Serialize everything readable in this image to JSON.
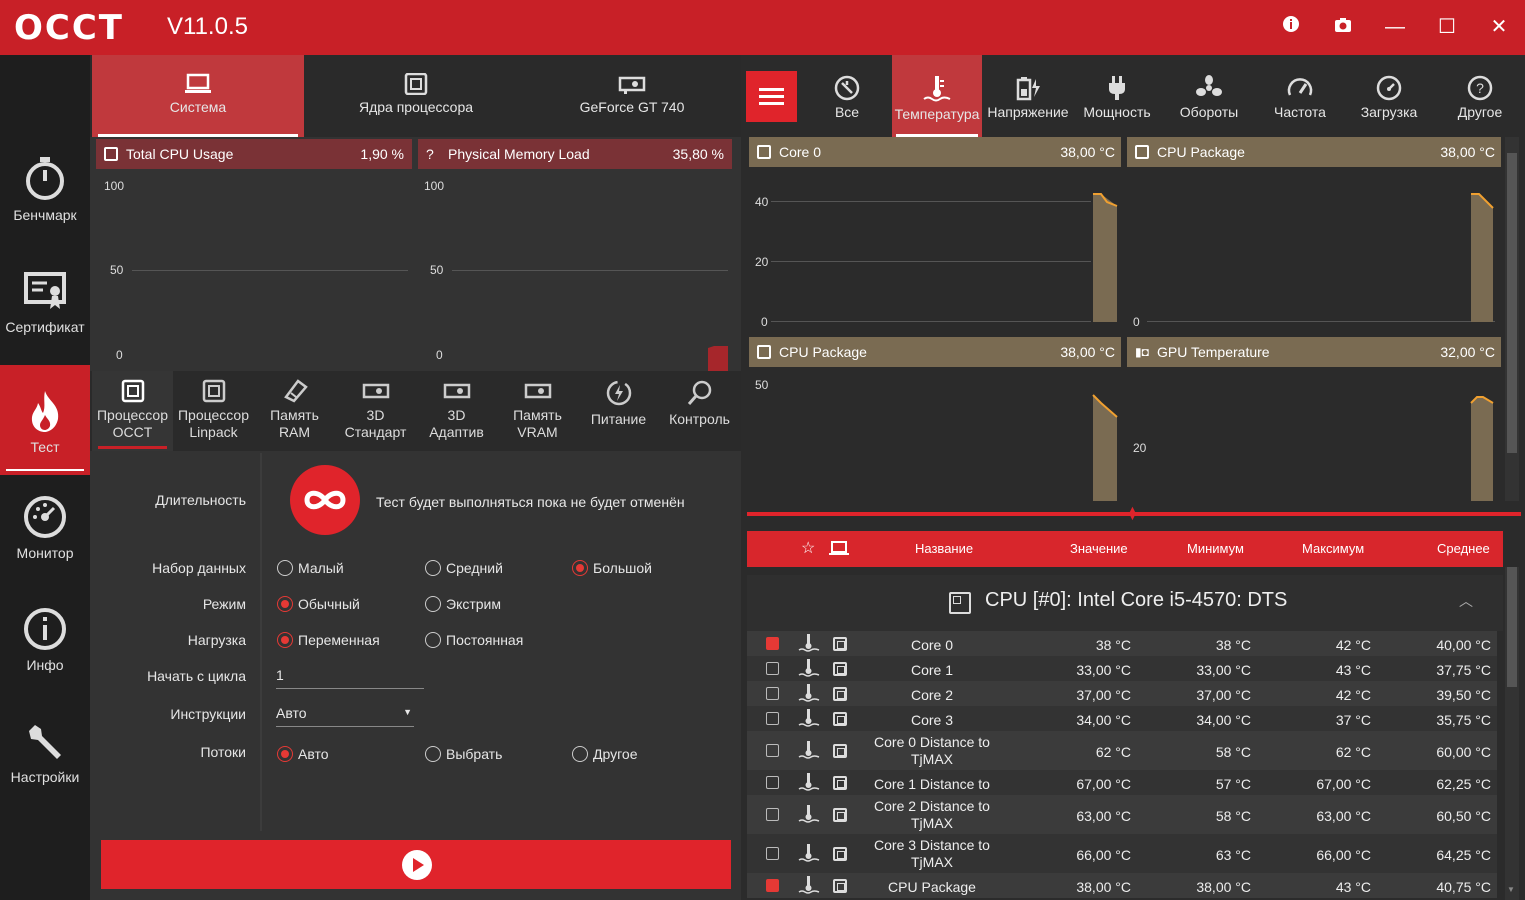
{
  "app": {
    "logo": "OCCT",
    "version": "V11.0.5"
  },
  "titlebar": {
    "info": "i",
    "camera": "camera-icon",
    "minimize": "—",
    "maximize": "☐",
    "close": "✕"
  },
  "sidebar": {
    "items": [
      {
        "label": "Бенчмарк",
        "icon": "stopwatch-icon"
      },
      {
        "label": "Сертификат",
        "icon": "certificate-icon"
      },
      {
        "label": "Тест",
        "icon": "flame-icon",
        "active": true
      },
      {
        "label": "Монитор",
        "icon": "gauge-icon"
      },
      {
        "label": "Инфо",
        "icon": "info-icon"
      },
      {
        "label": "Настройки",
        "icon": "wrench-icon"
      }
    ]
  },
  "left_tabs": [
    {
      "label": "Система",
      "active": true
    },
    {
      "label": "Ядра процессора"
    },
    {
      "label": "GeForce GT 740"
    }
  ],
  "cpu_chart": {
    "name": "Total CPU Usage",
    "value": "1,90 %",
    "ticks": [
      "100",
      "50",
      "0"
    ]
  },
  "mem_chart": {
    "name": "Physical Memory Load",
    "value": "35,80 %",
    "ticks": [
      "100",
      "50",
      "0"
    ]
  },
  "tests": [
    {
      "l1": "Процессор",
      "l2": "OCCT",
      "active": true
    },
    {
      "l1": "Процессор",
      "l2": "Linpack"
    },
    {
      "l1": "Память",
      "l2": "RAM"
    },
    {
      "l1": "3D",
      "l2": "Стандарт"
    },
    {
      "l1": "3D",
      "l2": "Адаптив"
    },
    {
      "l1": "Память",
      "l2": "VRAM"
    },
    {
      "l1": "Питание",
      "l2": ""
    },
    {
      "l1": "Контроль",
      "l2": ""
    }
  ],
  "settings": {
    "duration_label": "Длительность",
    "duration_text": "Тест будет выполняться пока не будет отменён",
    "dataset_label": "Набор данных",
    "dataset_opts": [
      "Малый",
      "Средний",
      "Большой"
    ],
    "mode_label": "Режим",
    "mode_opts": [
      "Обычный",
      "Экстрим"
    ],
    "load_label": "Нагрузка",
    "load_opts": [
      "Переменная",
      "Постоянная"
    ],
    "start_cycle_label": "Начать с цикла",
    "start_cycle_value": "1",
    "instructions_label": "Инструкции",
    "instructions_value": "Авто",
    "threads_label": "Потоки",
    "threads_opts": [
      "Авто",
      "Выбрать",
      "Другое"
    ]
  },
  "monitor_tabs": [
    {
      "label": "Все",
      "icon": "all-icon"
    },
    {
      "label": "Температура",
      "icon": "thermometer-icon",
      "active": true
    },
    {
      "label": "Напряжение",
      "icon": "battery-icon"
    },
    {
      "label": "Мощность",
      "icon": "plug-icon"
    },
    {
      "label": "Обороты",
      "icon": "fan-icon"
    },
    {
      "label": "Частота",
      "icon": "speedometer-icon"
    },
    {
      "label": "Загрузка",
      "icon": "load-icon"
    },
    {
      "label": "Другое",
      "icon": "question-icon"
    }
  ],
  "temp_charts": [
    {
      "name": "Core 0",
      "value": "38,00 °C",
      "ticks": [
        "40",
        "20",
        "0"
      ]
    },
    {
      "name": "CPU Package",
      "value": "38,00 °C",
      "ticks": [
        "0"
      ]
    },
    {
      "name": "CPU Package",
      "value": "38,00 °C",
      "ticks": [
        "50"
      ]
    },
    {
      "name": "GPU Temperature",
      "value": "32,00 °C",
      "ticks": [
        "20"
      ]
    }
  ],
  "table": {
    "headers": {
      "name": "Название",
      "value": "Значение",
      "min": "Минимум",
      "max": "Максимум",
      "avg": "Среднее"
    },
    "group": "CPU [#0]: Intel Core i5-4570: DTS",
    "rows": [
      {
        "checked": true,
        "name": "Core 0",
        "value": "38 °C",
        "min": "38 °C",
        "max": "42 °C",
        "avg": "40,00 °C"
      },
      {
        "checked": false,
        "name": "Core 1",
        "value": "33,00 °C",
        "min": "33,00 °C",
        "max": "43 °C",
        "avg": "37,75 °C"
      },
      {
        "checked": false,
        "name": "Core 2",
        "value": "37,00 °C",
        "min": "37,00 °C",
        "max": "42 °C",
        "avg": "39,50 °C"
      },
      {
        "checked": false,
        "name": "Core 3",
        "value": "34,00 °C",
        "min": "34,00 °C",
        "max": "37 °C",
        "avg": "35,75 °C"
      },
      {
        "checked": false,
        "name": "Core 0 Distance to TjMAX",
        "value": "62 °C",
        "min": "58 °C",
        "max": "62 °C",
        "avg": "60,00 °C"
      },
      {
        "checked": false,
        "name": "Core 1 Distance to TjMAX",
        "value": "67,00 °C",
        "min": "57 °C",
        "max": "67,00 °C",
        "avg": "62,25 °C"
      },
      {
        "checked": false,
        "name": "Core 2 Distance to TjMAX",
        "value": "63,00 °C",
        "min": "58 °C",
        "max": "63,00 °C",
        "avg": "60,50 °C"
      },
      {
        "checked": false,
        "name": "Core 3 Distance to TjMAX",
        "value": "66,00 °C",
        "min": "63 °C",
        "max": "66,00 °C",
        "avg": "64,25 °C"
      },
      {
        "checked": true,
        "name": "CPU Package",
        "value": "38,00 °C",
        "min": "38,00 °C",
        "max": "43 °C",
        "avg": "40,75 °C"
      }
    ]
  },
  "colors": {
    "accent": "#c82027",
    "temp_header": "#7a6b52",
    "cpu_header": "#7a3236"
  }
}
